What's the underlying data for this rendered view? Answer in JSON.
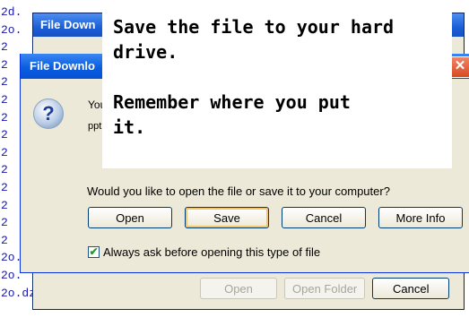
{
  "background_files": [
    "2d.",
    "2o.",
    "2",
    "2",
    "2",
    "2",
    "2",
    "2",
    "2",
    "2",
    "2",
    "2",
    "2",
    "2",
    "2o.",
    "2o.",
    "2o.dz"
  ],
  "back_window": {
    "title": "File Down",
    "buttons": {
      "open": "Open",
      "open_folder": "Open Folder",
      "cancel": "Cancel"
    }
  },
  "front_window": {
    "title": "File Downlo",
    "close_glyph": "✕",
    "help_glyph": "?",
    "you_text": "You",
    "file_prefix": "ppt1",
    "question": "Would you like to open the file or save it to your computer?",
    "buttons": {
      "open": "Open",
      "save": "Save",
      "cancel": "Cancel",
      "more_info": "More Info"
    },
    "checkbox": {
      "label": "Always ask before opening this type of file",
      "checked": true,
      "mark": "✔"
    }
  },
  "overlay": {
    "line1": "Save the file to your hard",
    "line2": "drive.",
    "line3": "Remember where you put",
    "line4": "it."
  }
}
